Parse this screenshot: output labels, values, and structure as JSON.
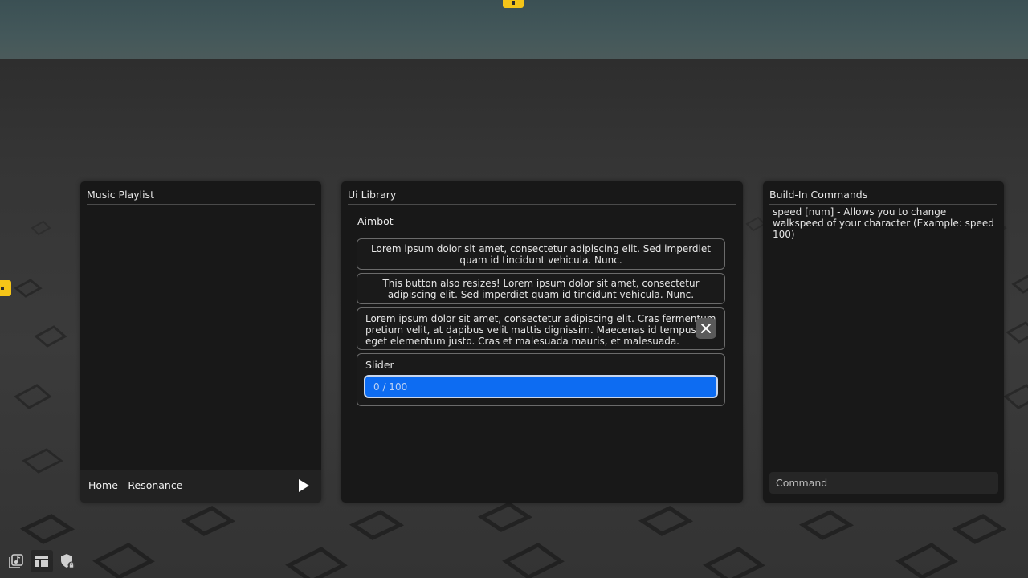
{
  "music": {
    "title": "Music Playlist",
    "now_playing": "Home - Resonance",
    "play_icon": "play-icon"
  },
  "library": {
    "title": "Ui Library",
    "section": "Aimbot",
    "buttons": [
      "Lorem ipsum dolor sit amet, consectetur adipiscing elit. Sed imperdiet quam id tincidunt vehicula. Nunc.",
      "This button also resizes! Lorem ipsum dolor sit amet, consectetur adipiscing elit. Sed imperdiet quam id tincidunt vehicula. Nunc."
    ],
    "notice": "Lorem ipsum dolor sit amet, consectetur adipiscing elit. Cras fermentum pretium velit, at dapibus velit mattis dignissim. Maecenas id tempus eget elementum justo. Cras et malesuada mauris, et malesuada.",
    "slider": {
      "label": "Slider",
      "value_text": "0 / 100",
      "value": 0,
      "max": 100
    }
  },
  "commands": {
    "title": "Build-In Commands",
    "help": "speed [num] - Allows you to change walkspeed of your character (Example: speed 100)",
    "input_placeholder": "Command"
  },
  "toolbar": {
    "icons": [
      "music-library-icon",
      "layout-icon",
      "shield-lock-icon"
    ]
  },
  "colors": {
    "panel_bg": "#181818",
    "accent": "#0d6cf2",
    "gizmo": "#f5c518"
  }
}
